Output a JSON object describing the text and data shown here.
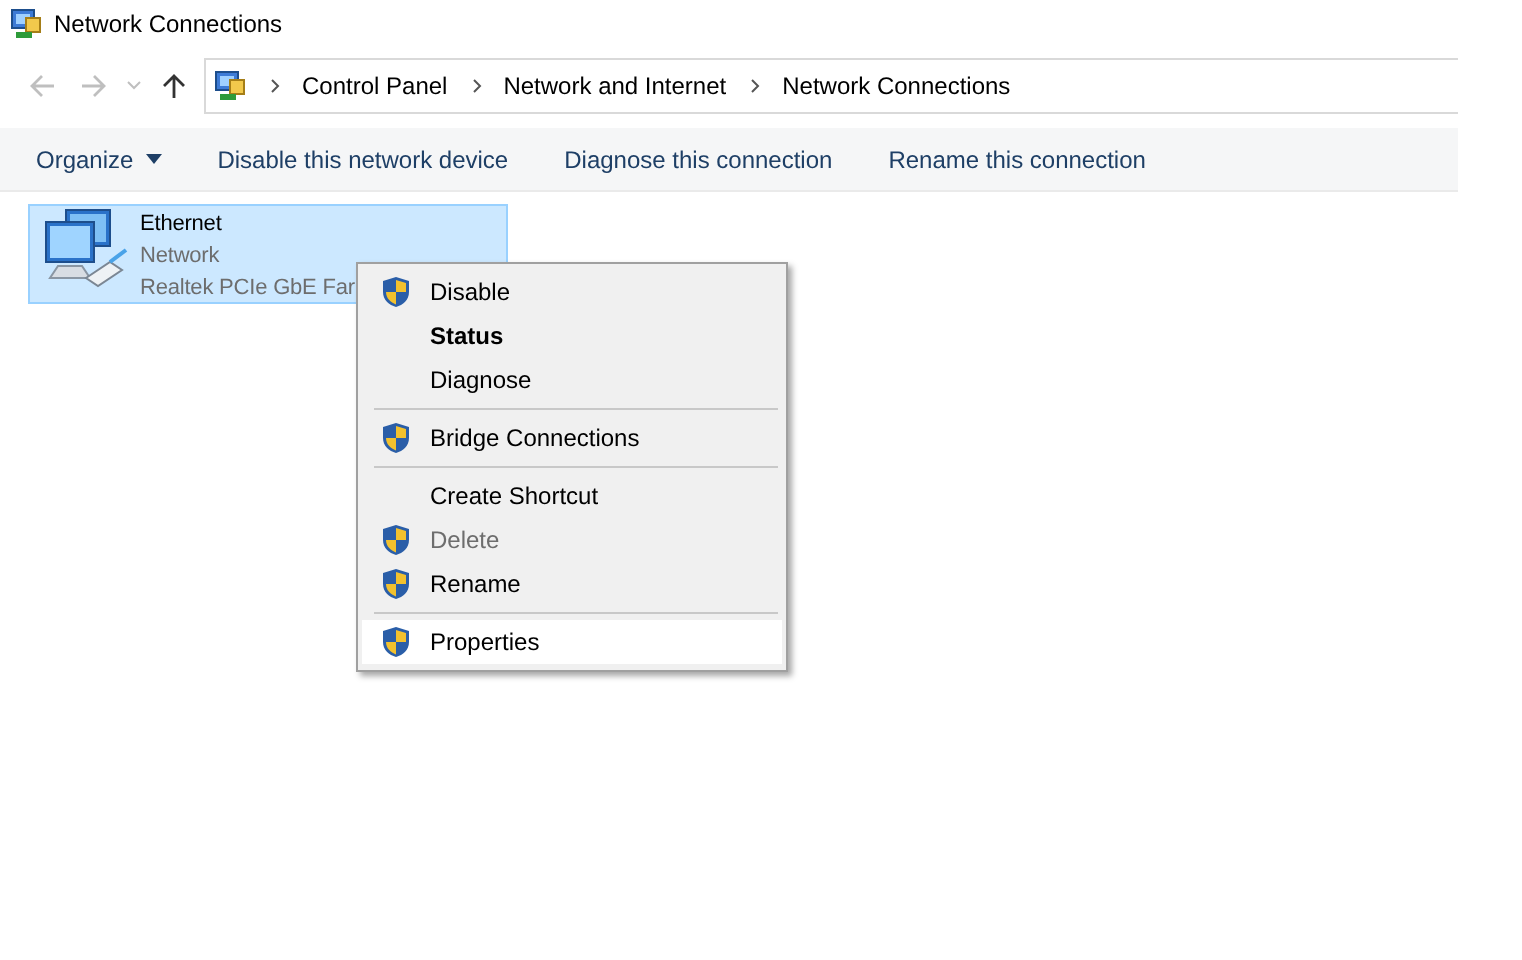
{
  "window": {
    "title": "Network Connections"
  },
  "navigation": {
    "back_enabled": false,
    "forward_enabled": false,
    "up_enabled": true
  },
  "breadcrumb": [
    "Control Panel",
    "Network and Internet",
    "Network Connections"
  ],
  "toolbar": [
    {
      "label": "Organize",
      "dropdown": true
    },
    {
      "label": "Disable this network device",
      "dropdown": false
    },
    {
      "label": "Diagnose this connection",
      "dropdown": false
    },
    {
      "label": "Rename this connection",
      "dropdown": false
    }
  ],
  "connections": [
    {
      "name": "Ethernet",
      "status": "Network",
      "device": "Realtek PCIe GbE Far",
      "selected": true
    }
  ],
  "context_menu": [
    {
      "kind": "item",
      "label": "Disable",
      "shield": true,
      "default": false,
      "disabled": false,
      "selected": false
    },
    {
      "kind": "item",
      "label": "Status",
      "shield": false,
      "default": true,
      "disabled": false,
      "selected": false
    },
    {
      "kind": "item",
      "label": "Diagnose",
      "shield": false,
      "default": false,
      "disabled": false,
      "selected": false
    },
    {
      "kind": "separator"
    },
    {
      "kind": "item",
      "label": "Bridge Connections",
      "shield": true,
      "default": false,
      "disabled": false,
      "selected": false
    },
    {
      "kind": "separator"
    },
    {
      "kind": "item",
      "label": "Create Shortcut",
      "shield": false,
      "default": false,
      "disabled": false,
      "selected": false
    },
    {
      "kind": "item",
      "label": "Delete",
      "shield": true,
      "default": false,
      "disabled": true,
      "selected": false
    },
    {
      "kind": "item",
      "label": "Rename",
      "shield": true,
      "default": false,
      "disabled": false,
      "selected": false
    },
    {
      "kind": "separator"
    },
    {
      "kind": "item",
      "label": "Properties",
      "shield": true,
      "default": false,
      "disabled": false,
      "selected": true
    }
  ]
}
